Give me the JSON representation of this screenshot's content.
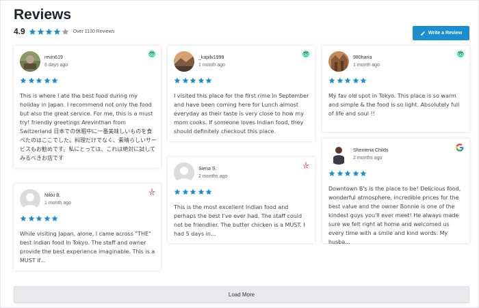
{
  "header": {
    "title": "Reviews",
    "rating": "4.9",
    "count_text": "Over 1130 Reviews",
    "write_button_label": "Write a Review"
  },
  "colors": {
    "star": "#1b8dd1",
    "button": "#1b8dd1",
    "tripadvisor": "#34e0a1",
    "yelp": "#d32323"
  },
  "reviews": [
    {
      "name": "revin619",
      "date": "6 days ago",
      "stars": 5,
      "source": "tripadvisor-icon",
      "text": "This is where I ate the best food during my holiday in Japan. I recommend not only the food but also the great service. For me, this is a must try! friendly greetings Arevinthan from Switzerland 日本での休暇中に一番美味しいものを食べたのはここでした。料理だけでなく、素晴らしいサービスもお勧めです。私にとっては、これは絶対に試してみるべきお店です"
    },
    {
      "name": "_kapilv1999",
      "date": "1 month ago",
      "stars": 5,
      "source": "tripadvisor-icon",
      "text": "I visited this place for the first rime in September and have been coming here for Lunch almost everyday as their taste is very close to how my mom cooks. If someone loves Indian food, they should definitely checkout this place."
    },
    {
      "name": "980haria",
      "date": "1 month ago",
      "stars": 5,
      "source": "tripadvisor-icon",
      "text": "My fav old spot in Tokyo. This place is so warm and simple & the food is so light. Absolutely full of life and soul !!"
    },
    {
      "name": "Nikki B.",
      "date": "1 month ago",
      "stars": 5,
      "source": "yelp-icon",
      "text": "While visiting Japan, alone, I came across \"THE\" best Indian food in Tokyo. The staff and owner provide the best experience imaginable. This is a MUST if..."
    },
    {
      "name": "Siena S.",
      "date": "2 months ago",
      "stars": 5,
      "source": "yelp-icon",
      "text": "This is the most excellent Indian food and perhaps the best I've ever had. The staff could not be friendlier. The butter chicken is a MUST. I had 5 days in..."
    },
    {
      "name": "Shenteria Childs",
      "date": "2 months ago",
      "stars": 5,
      "source": "google-icon",
      "text": "Downtown B's is the place to be! Delicious food, wonderful atmosphere, incredible prices for the best value and the owner Bonnie is one of the kindest guys you'll ever meet! He always made sure we felt right at home and welcomed us every time with a smile and kind words. My husba..."
    }
  ],
  "load_more_label": "Load More"
}
